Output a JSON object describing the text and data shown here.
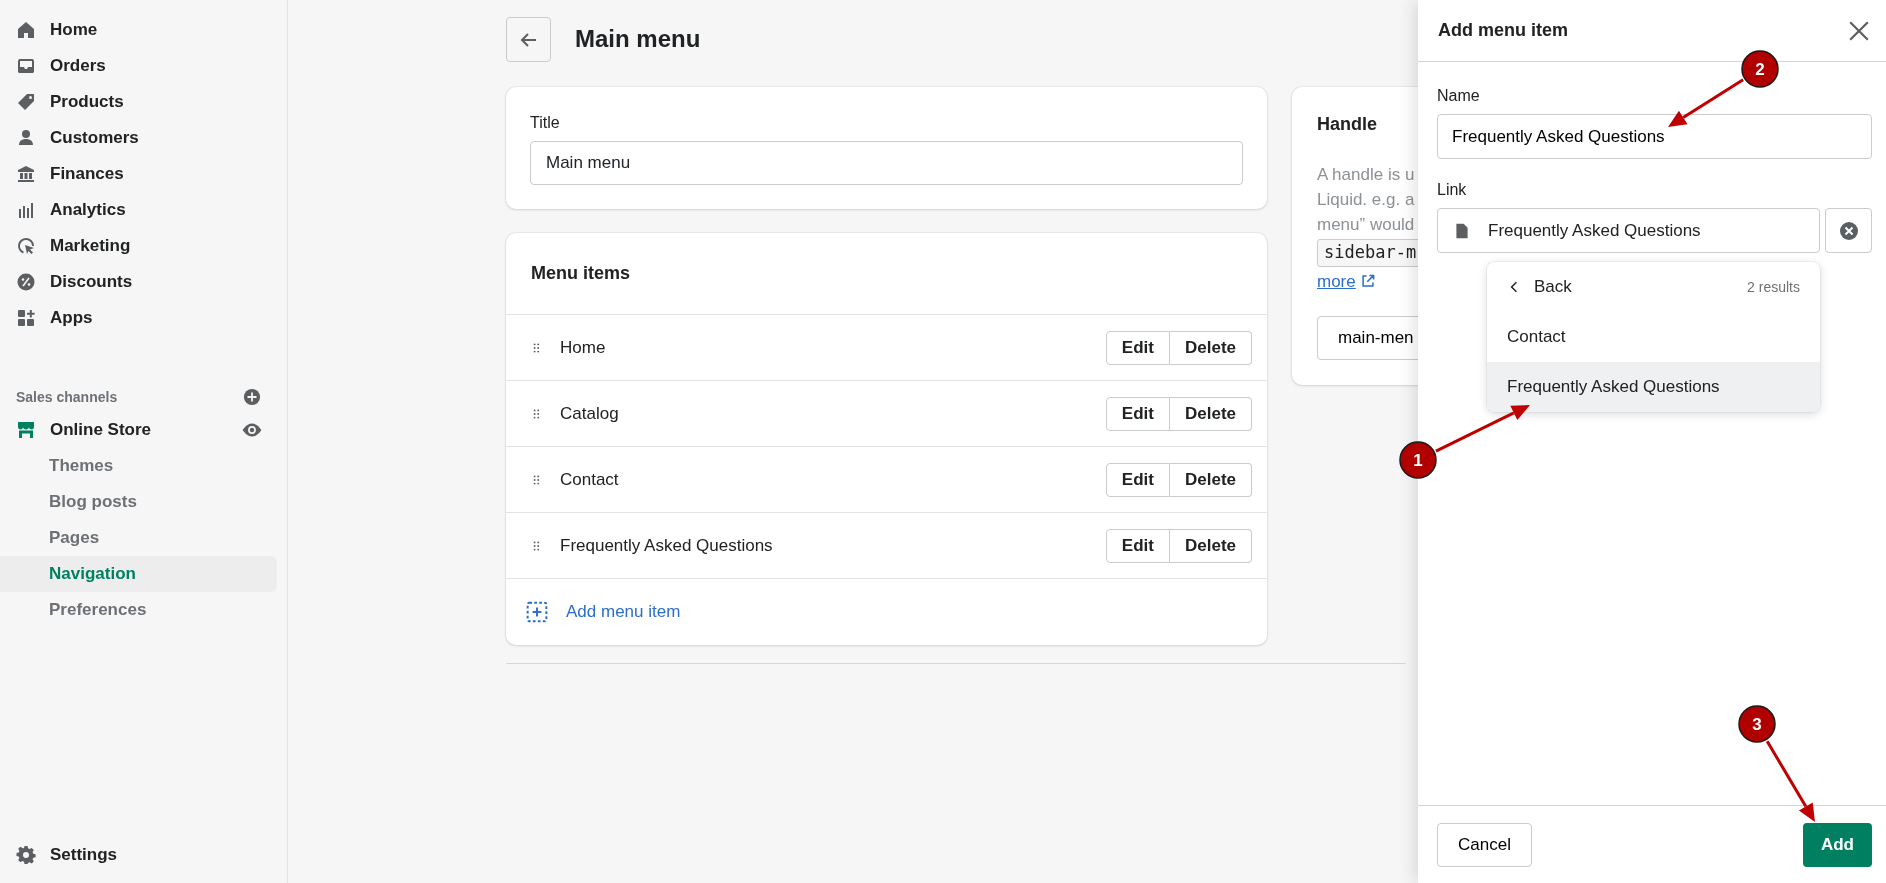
{
  "sidebar": {
    "items": [
      {
        "label": "Home"
      },
      {
        "label": "Orders"
      },
      {
        "label": "Products"
      },
      {
        "label": "Customers"
      },
      {
        "label": "Finances"
      },
      {
        "label": "Analytics"
      },
      {
        "label": "Marketing"
      },
      {
        "label": "Discounts"
      },
      {
        "label": "Apps"
      }
    ],
    "section_title": "Sales channels",
    "channel": {
      "label": "Online Store"
    },
    "sub_items": [
      {
        "label": "Themes",
        "selected": false
      },
      {
        "label": "Blog posts",
        "selected": false
      },
      {
        "label": "Pages",
        "selected": false
      },
      {
        "label": "Navigation",
        "selected": true
      },
      {
        "label": "Preferences",
        "selected": false
      }
    ],
    "settings": {
      "label": "Settings"
    }
  },
  "page_title": "Main menu",
  "title_card": {
    "label": "Title",
    "value": "Main menu"
  },
  "menu_items": {
    "heading": "Menu items",
    "rows": [
      {
        "label": "Home",
        "edit": "Edit",
        "delete": "Delete"
      },
      {
        "label": "Catalog",
        "edit": "Edit",
        "delete": "Delete"
      },
      {
        "label": "Contact",
        "edit": "Edit",
        "delete": "Delete"
      },
      {
        "label": "Frequently Asked Questions",
        "edit": "Edit",
        "delete": "Delete"
      }
    ],
    "add_link": "Add menu item"
  },
  "handle": {
    "heading": "Handle",
    "lines": [
      "A handle is u",
      "Liquid. e.g. a",
      "menu” would"
    ],
    "code": "sidebar-m",
    "link": "more",
    "value": "main-men"
  },
  "drawer": {
    "title": "Add menu item",
    "name": {
      "label": "Name",
      "value": "Frequently Asked Questions"
    },
    "link": {
      "label": "Link",
      "value": "Frequently Asked Questions"
    },
    "dropdown": {
      "back": "Back",
      "count": "2 results",
      "options": [
        {
          "label": "Contact",
          "selected": false
        },
        {
          "label": "Frequently Asked Questions",
          "selected": true
        }
      ]
    },
    "cancel": "Cancel",
    "add": "Add"
  },
  "annotations": [
    {
      "label": "1"
    },
    {
      "label": "2"
    },
    {
      "label": "3"
    }
  ]
}
